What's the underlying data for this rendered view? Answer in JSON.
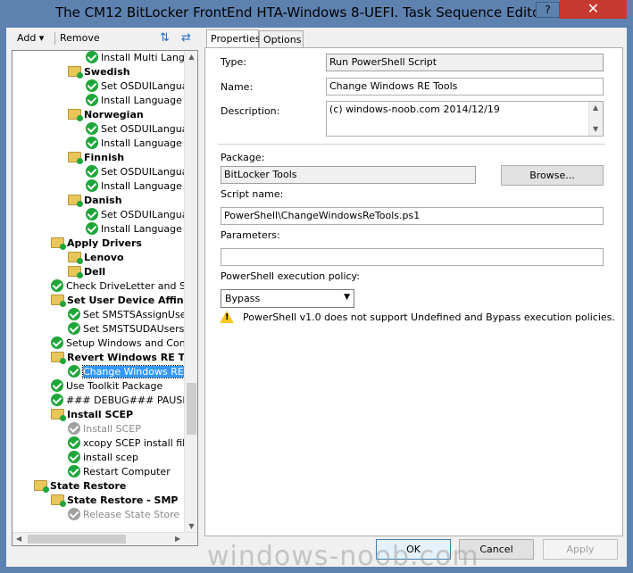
{
  "window": {
    "title": "The CM12 BitLocker FrontEnd HTA-Windows 8-UEFI. Task Sequence Editor",
    "help_glyph": "?",
    "close_glyph": "✕"
  },
  "toolbar": {
    "add_label": "Add ▾",
    "remove_label": "Remove"
  },
  "tree": {
    "nodes": [
      {
        "label": "Install Multi Languag",
        "icon": "ok"
      },
      {
        "label": "Swedish",
        "icon": "folder",
        "bold": true
      },
      {
        "label": "Set OSDUILanguag",
        "icon": "ok"
      },
      {
        "label": "Install Language Pa",
        "icon": "ok"
      },
      {
        "label": "Norwegian",
        "icon": "folder",
        "bold": true
      },
      {
        "label": "Set OSDUILanguag",
        "icon": "ok"
      },
      {
        "label": "Install Language Pa",
        "icon": "ok"
      },
      {
        "label": "Finnish",
        "icon": "folder",
        "bold": true
      },
      {
        "label": "Set OSDUILanguag",
        "icon": "ok"
      },
      {
        "label": "Install Language Pa",
        "icon": "ok"
      },
      {
        "label": "Danish",
        "icon": "folder",
        "bold": true
      },
      {
        "label": "Set OSDUILanguag",
        "icon": "ok"
      },
      {
        "label": "Install Language Pa",
        "icon": "ok"
      },
      {
        "label": "Apply Drivers",
        "icon": "folder",
        "bold": true
      },
      {
        "label": "Lenovo",
        "icon": "folder",
        "bold": true
      },
      {
        "label": "Dell",
        "icon": "folder",
        "bold": true
      },
      {
        "label": "Check DriveLetter and Set C",
        "icon": "ok"
      },
      {
        "label": "Set User Device Affinity",
        "icon": "folder",
        "bold": true
      },
      {
        "label": "Set SMSTSAssignUsers",
        "icon": "ok"
      },
      {
        "label": "Set SMSTSUDAUsers",
        "icon": "ok"
      },
      {
        "label": "Setup Windows and Configu",
        "icon": "ok"
      },
      {
        "label": "Revert Windows RE To",
        "icon": "folder",
        "bold": true
      },
      {
        "label": "Change Windows RE T",
        "icon": "ok",
        "selected": true
      },
      {
        "label": "Use Toolkit Package",
        "icon": "ok"
      },
      {
        "label": "### DEBUG### PAUSE T",
        "icon": "ok"
      },
      {
        "label": "Install SCEP",
        "icon": "folder",
        "bold": true
      },
      {
        "label": "Install SCEP",
        "icon": "grey",
        "disabled": true
      },
      {
        "label": "xcopy SCEP install files",
        "icon": "ok"
      },
      {
        "label": "install scep",
        "icon": "ok"
      },
      {
        "label": "Restart Computer",
        "icon": "ok"
      },
      {
        "label": "State Restore",
        "icon": "folder",
        "bold": true
      },
      {
        "label": "State Restore - SMP",
        "icon": "folder",
        "bold": true
      },
      {
        "label": "Release State Store",
        "icon": "grey",
        "disabled": true
      }
    ]
  },
  "tabs": [
    {
      "label": "Properties",
      "active": true
    },
    {
      "label": "Options",
      "active": false
    }
  ],
  "properties": {
    "type_label": "Type:",
    "type_value": "Run PowerShell Script",
    "name_label": "Name:",
    "name_value": "Change Windows RE Tools",
    "description_label": "Description:",
    "description_value": "(c) windows-noob.com 2014/12/19",
    "package_label": "Package:",
    "package_value": "BitLocker Tools",
    "browse_label": "Browse...",
    "script_name_label": "Script name:",
    "script_name_value": "PowerShell\\ChangeWindowsReTools.ps1",
    "parameters_label": "Parameters:",
    "parameters_value": "",
    "policy_label": "PowerShell execution policy:",
    "policy_value": "Bypass",
    "warning_text": "PowerShell v1.0 does not support Undefined and Bypass execution policies."
  },
  "footer": {
    "ok_label": "OK",
    "cancel_label": "Cancel",
    "apply_label": "Apply"
  },
  "watermark": "windows-noob.com"
}
